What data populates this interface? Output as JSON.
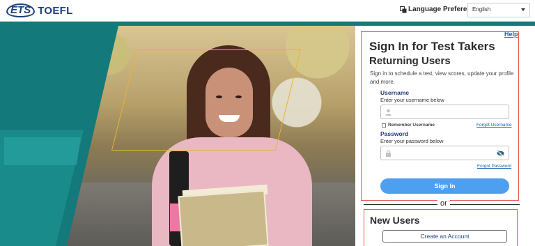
{
  "header": {
    "logo_ets": "ETS",
    "logo_toefl": "TOEFL",
    "language_label": "Language Preference",
    "language_selected": "English"
  },
  "signin": {
    "help": "Help",
    "title": "Sign In for Test Takers",
    "subtitle": "Returning Users",
    "description": "Sign in to schedule a test, view scores, update your profile and more.",
    "username_label": "Username",
    "username_hint": "Enter your username below",
    "remember_label": "Remember Username",
    "forgot_username": "Forgot Username",
    "password_label": "Password",
    "password_hint": "Enter your password below",
    "forgot_password": "Forgot Password",
    "signin_button": "Sign In",
    "or": "or"
  },
  "new_users": {
    "title": "New Users",
    "create_button": "Create an Account"
  },
  "colors": {
    "teal": "#127a7a",
    "accent_red": "#e2574c",
    "button_blue": "#4e9ff0",
    "link_blue": "#1a5fa8"
  }
}
